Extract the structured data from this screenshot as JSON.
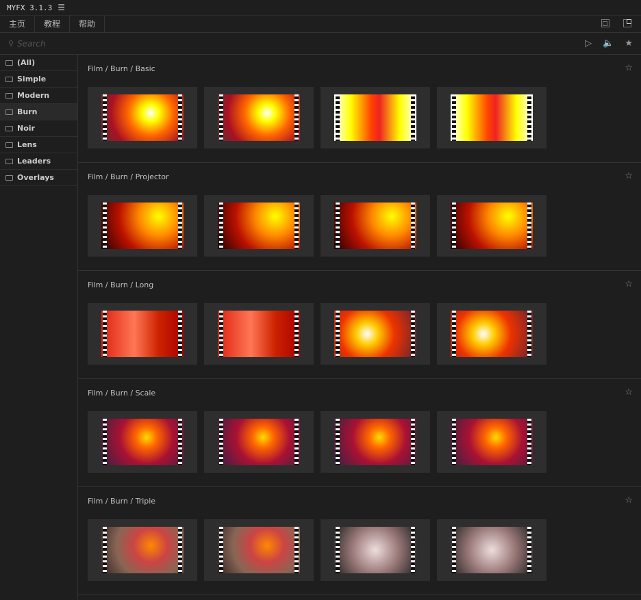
{
  "app": {
    "title": "MYFX 3.1.3",
    "menu_icon": "☰"
  },
  "tabs": [
    "主页",
    "教程",
    "帮助"
  ],
  "search": {
    "placeholder": "Search",
    "value": ""
  },
  "sidebar": {
    "items": [
      "(All)",
      "Simple",
      "Modern",
      "Burn",
      "Noir",
      "Lens",
      "Leaders",
      "Overlays"
    ],
    "active": "Burn"
  },
  "sections": [
    {
      "title": "Film / Burn / Basic"
    },
    {
      "title": "Film / Burn / Projector"
    },
    {
      "title": "Film / Burn / Long"
    },
    {
      "title": "Film / Burn / Scale"
    },
    {
      "title": "Film / Burn / Triple"
    }
  ]
}
